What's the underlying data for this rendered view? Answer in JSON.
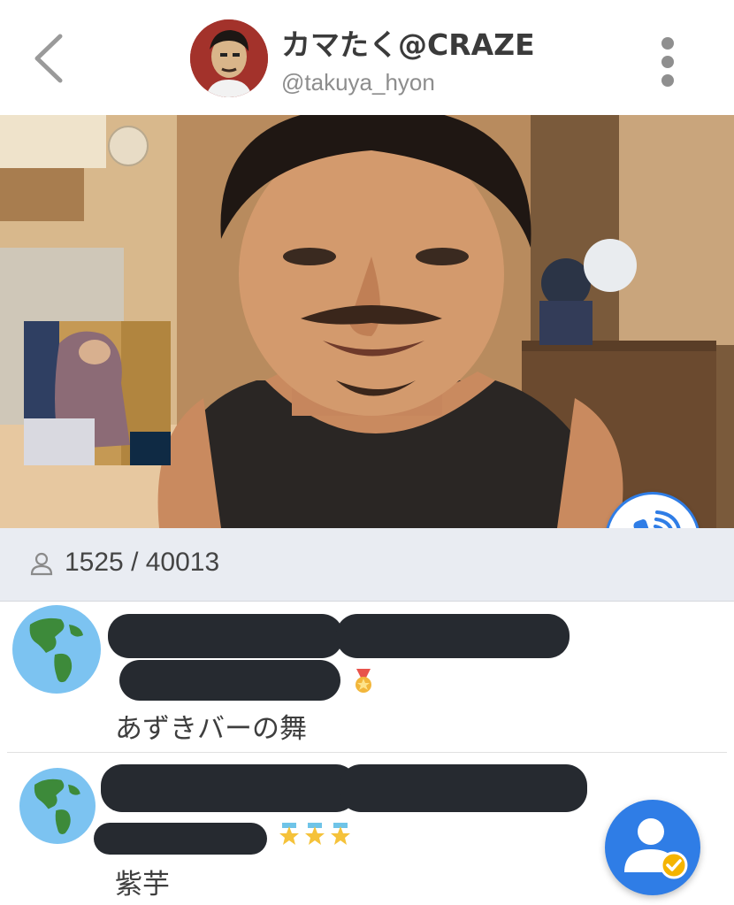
{
  "header": {
    "back_icon": "chevron-left-icon",
    "host_name": "カマたく@CRAZE",
    "host_handle": "@takuya_hyon",
    "more_icon": "more-vertical-icon"
  },
  "viewers": {
    "icon": "person-outline-icon",
    "count_text": "1525 / 40013"
  },
  "comments": [
    {
      "avatar_icon": "globe-icon",
      "badge": "medal-icon",
      "text": "あずきバーの舞"
    },
    {
      "avatar_icon": "globe-icon",
      "badge": "three-stars-icon",
      "text": "紫芋"
    }
  ],
  "buttons": {
    "call_icon": "phone-ringing-icon",
    "follow_icon": "user-check-icon"
  },
  "colors": {
    "accent": "#2f7de6",
    "viewer_bar": "#e9ecf2",
    "redaction": "#262a30"
  }
}
